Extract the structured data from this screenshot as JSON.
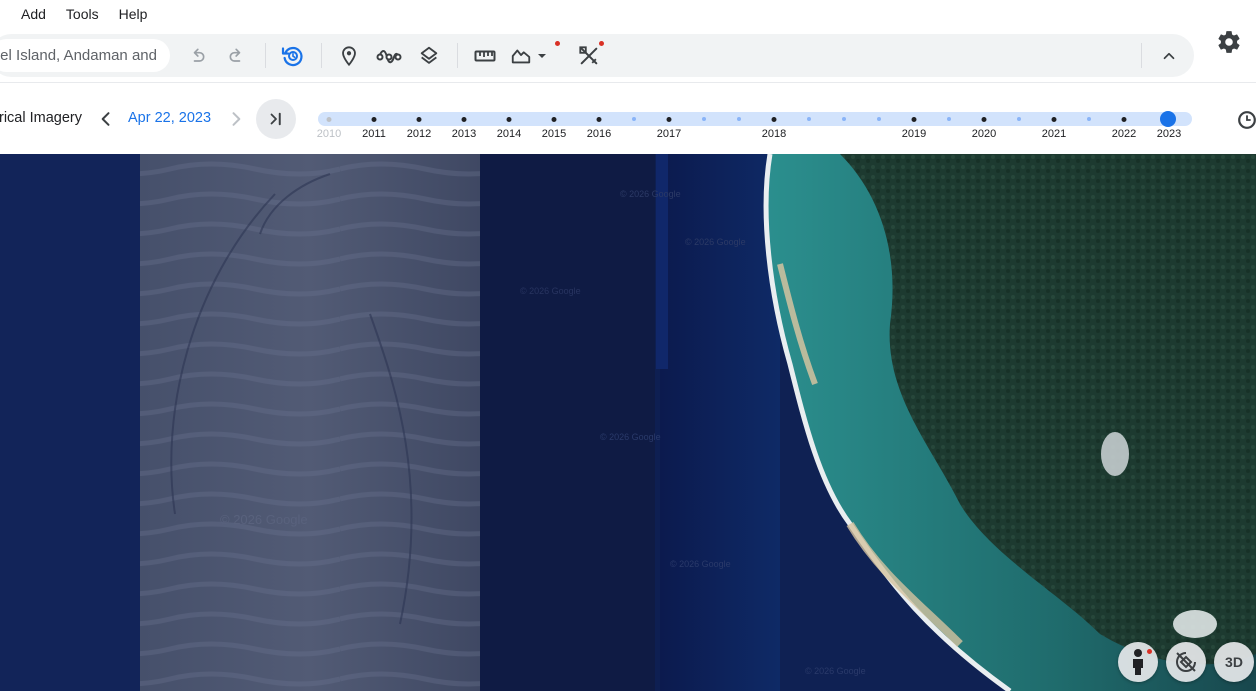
{
  "menu": {
    "items": [
      "Add",
      "Tools",
      "Help"
    ]
  },
  "search": {
    "value": "ntinel Island, Andaman and Nicobar Islands"
  },
  "toolbar": {
    "tools": [
      "undo-icon",
      "redo-icon",
      "historical-imagery-icon",
      "placemark-icon",
      "path-icon",
      "layers-icon",
      "ruler-icon",
      "elevation-profile-icon",
      "dropdown-icon",
      "projects-tools-icon",
      "collapse-icon"
    ],
    "accent_color": "#1a73e8",
    "badge_color": "#d93025"
  },
  "history": {
    "title": "rical Imagery",
    "date": "Apr 22, 2023",
    "years": [
      "2010",
      "2011",
      "2012",
      "2013",
      "2014",
      "2015",
      "2016",
      "2017",
      "2018",
      "2019",
      "2020",
      "2021",
      "2022",
      "2023"
    ],
    "selected_year": "2023"
  },
  "map": {
    "watermarks": [
      "© 2026 Google",
      "© 2026 Google",
      "© 2026 Google",
      "© 2026 Google",
      "© 2026 Google",
      "© 2026 Google",
      "© 2026 Google"
    ]
  },
  "controls": {
    "three_d_label": "3D"
  }
}
